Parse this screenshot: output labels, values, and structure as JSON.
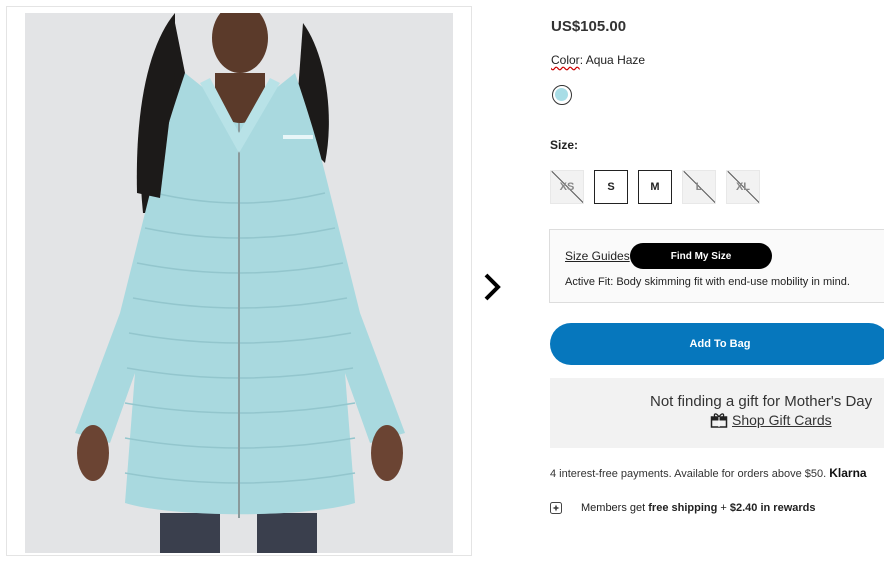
{
  "product": {
    "price": "US$105.00",
    "color_label": "Color",
    "color_value": "Aqua Haze",
    "swatch_color": "#a8dde6"
  },
  "sizes": {
    "label": "Size:",
    "options": [
      {
        "label": "XS",
        "available": false
      },
      {
        "label": "S",
        "available": true
      },
      {
        "label": "M",
        "available": true
      },
      {
        "label": "L",
        "available": false
      },
      {
        "label": "XL",
        "available": false
      }
    ]
  },
  "fit": {
    "size_guides": "Size Guides",
    "find_my_size": "Find My Size",
    "description": "Active Fit: Body skimming fit with end-use mobility in mind."
  },
  "add_to_bag": "Add To Bag",
  "gift": {
    "title": "Not finding a gift for Mother's Day",
    "link": "Shop Gift Cards"
  },
  "payments": {
    "text": "4 interest-free payments. Available for orders above $50.",
    "provider": "Klarna"
  },
  "members": {
    "prefix": "Members get",
    "shipping": "free shipping",
    "plus": "+",
    "rewards": "$2.40 in rewards"
  },
  "colors": {
    "accent": "#0677bd",
    "jacket": "#a9d9df",
    "background": "#e3e4e6"
  }
}
